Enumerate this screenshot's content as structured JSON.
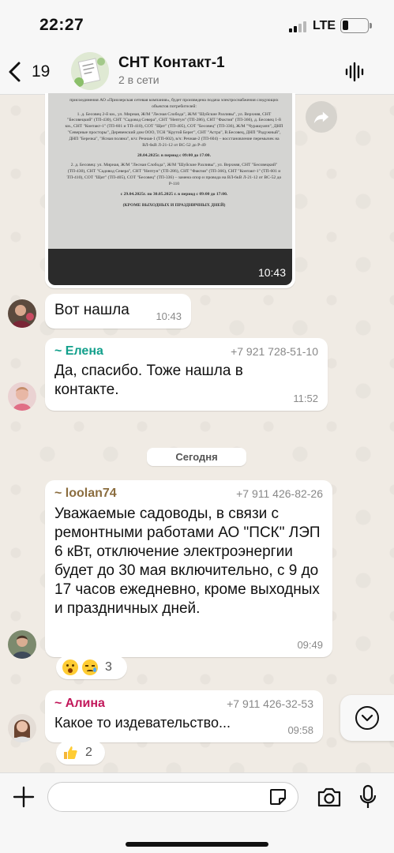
{
  "status_bar": {
    "time": "22:27",
    "carrier": "LTE",
    "battery_level": 0.22
  },
  "header": {
    "back_count": "19",
    "title": "СНТ Контакт-1",
    "subtitle": "2 в сети"
  },
  "media_message": {
    "time": "10:43",
    "doc_lines": [
      "присоединения АО «Приозерская сетевая компания», будет произведена подача электроснабжения следующих объектов потребителей:",
      "1. д. Бесовец 2-й км., ул. Мирная, Ж/М \"Лесная Слобода\", Ж/М \"Шуйские Разливы\", ул. Верхняя, СНТ \"Бесовецкий\" (ТП-430), СНТ \"Садовод Севера\", СНТ \"Нептун\" (ТП-286), СНТ \"Фактия\" (ТП-366), д. Бесовец 1-й км., СНТ \"Контакт-1\" (ТП-601 и ТП-410), СОТ \"Щит\" (ТП-405), СОТ \"Бесовец\" (ТП-336), Ж/М \"Чурашуапп\", ДНП \"Северные просторы\", Деревенский дом ООО, ТСН \"Крутой Берег\", СНТ \"Астра\", В.Бесовец, ДНП \"Радужный\", ДНП \"Березка\", \"Ясная поляна\", в/ч: Речная-1 (ТП-602), в/ч: Речная-2 (ТП-604) – восстановление перемычек на ВЛ-6кВ Л-21-12 от ВС-52 до Р-49",
      "28.04.2025г. в период с 09:00 до 17:00.",
      "2. д. Бесовец: ул. Мирная, Ж/М \"Лесная Слобода\", Ж/М \"Шуйские Разливы\", ул. Верхняя, СНТ \"Бесовецкий\" (ТП-430), СНТ \"Садовод Севера\", СНТ \"Нептун\" (ТП-286), СНТ \"Фактия\" (ТП-366), СНТ \"Контакт-1\" (ТП-601 и ТП-410), СОТ \"Щит\" (ТП-405), СОТ \"Бесовец\" (ТП-336) – замена опор и провода на ВЛ-6кВ Л-21-12 от ВС-52 до Р-110",
      "с 29.04.2025г. по 30.05.2025 г. в период с 09:00 до 17:00.",
      "(КРОМЕ ВЫХОДНЫХ И ПРАЗДНИЧНЫХ ДНЕЙ)"
    ]
  },
  "messages": [
    {
      "sender": "",
      "phone": "",
      "text": "Вот нашла",
      "time": "10:43"
    },
    {
      "sender": "~ Елена",
      "phone": "+7 921 728-51-10",
      "text": "Да, спасибо. Тоже нашла в контакте.",
      "time": "11:52"
    },
    {
      "sender": "~ loolan74",
      "phone": "+7 911 426-82-26",
      "text": "Уважаемые садоводы, в связи с ремонтными работами АО \"ПСК\" ЛЭП 6 кВт, отключение электроэнергии будет до 30 мая включительно, с 9 до 17 часов ежедневно, кроме выходных и праздничных дней.",
      "time": "09:49"
    },
    {
      "sender": "~ Алина",
      "phone": "+7 911 426-32-53",
      "text": "Какое то издевательство...",
      "time": "09:58"
    }
  ],
  "day_separator": "Сегодня",
  "reactions": [
    {
      "emojis": [
        "surprised-face",
        "crying-face"
      ],
      "count": "3"
    },
    {
      "emojis": [
        "thumbs-up"
      ],
      "count": "2"
    }
  ],
  "colors": {
    "sender_elena": "#13a08c",
    "sender_loolan": "#8b6d3f",
    "sender_alina": "#c2185b",
    "chat_background": "#f0ebe4",
    "bubble": "#ffffff"
  },
  "input": {
    "placeholder": "",
    "value": ""
  }
}
